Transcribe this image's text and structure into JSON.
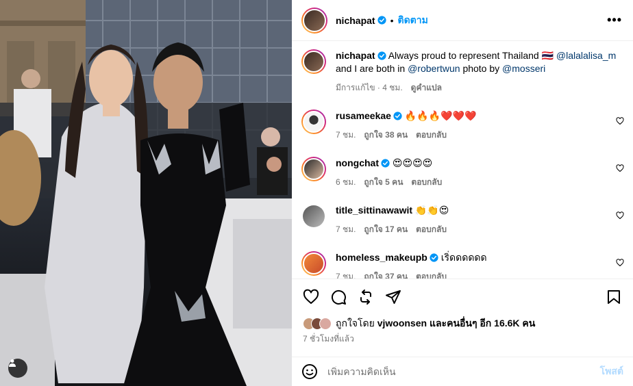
{
  "post": {
    "author": "nichapat",
    "follow_label": "ติดตาม",
    "more_label": "•••",
    "separator": "•"
  },
  "caption": {
    "username": "nichapat",
    "text_1": "Always proud to represent Thailand 🇹🇭",
    "mention_1": "@lalalalisa_m",
    "text_2": "and I are both in",
    "mention_2": "@robertwun",
    "text_3": "photo by",
    "mention_3": "@mosseri",
    "edited": "มีการแก้ไข · 4 ชม.",
    "translate": "ดูคำแปล"
  },
  "comments": [
    {
      "username": "rusameekae",
      "verified": true,
      "text": "🔥🔥🔥❤️❤️❤️",
      "time": "7 ชม.",
      "likes": "ถูกใจ 38 คน",
      "reply": "ตอบกลับ"
    },
    {
      "username": "nongchat",
      "verified": true,
      "text": "😍😍😍😍",
      "time": "6 ชม.",
      "likes": "ถูกใจ 5 คน",
      "reply": "ตอบกลับ"
    },
    {
      "username": "title_sittinawawit",
      "verified": false,
      "text": "👏👏😍",
      "time": "7 ชม.",
      "likes": "ถูกใจ 17 คน",
      "reply": "ตอบกลับ"
    },
    {
      "username": "homeless_makeupb",
      "verified": true,
      "text": "เริ่ดดดดดด",
      "time": "7 ชม.",
      "likes": "ถูกใจ 37 คน",
      "reply": "ตอบกลับ"
    }
  ],
  "likes": {
    "prefix": "ถูกใจโดย",
    "user": "vjwoonsen",
    "suffix": "และคนอื่นๆ อีก 16.6K คน"
  },
  "time_ago": "7 ชั่วโมงที่แล้ว",
  "composer": {
    "placeholder": "เพิ่มความคิดเห็น",
    "post_label": "โพสต์"
  },
  "icons": {
    "verified": "verified-badge-icon",
    "like": "heart-icon",
    "comment": "comment-icon",
    "share": "repost-icon",
    "send": "send-icon",
    "save": "bookmark-icon",
    "emoji": "emoji-icon",
    "tag": "user-tag-icon"
  },
  "colors": {
    "accent": "#0095f6",
    "mention": "#00376b",
    "secondary_text": "#737373",
    "post_disabled": "#b3dbff"
  }
}
